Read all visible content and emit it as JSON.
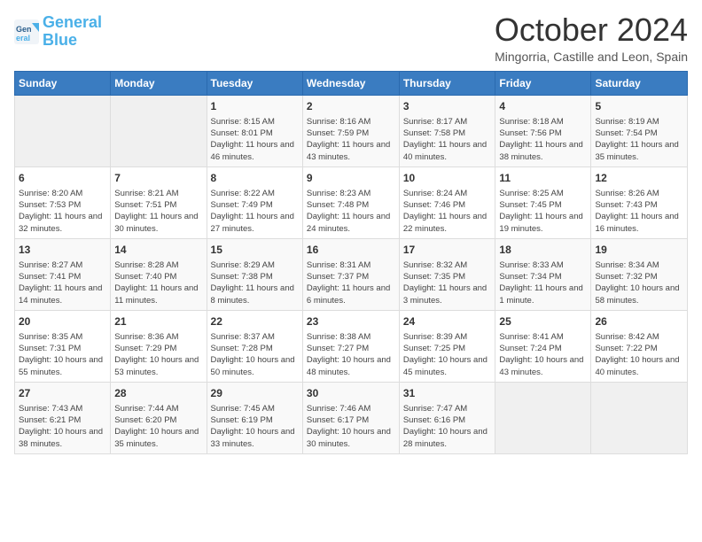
{
  "header": {
    "logo_line1": "General",
    "logo_line2": "Blue",
    "month_title": "October 2024",
    "location": "Mingorria, Castille and Leon, Spain"
  },
  "weekdays": [
    "Sunday",
    "Monday",
    "Tuesday",
    "Wednesday",
    "Thursday",
    "Friday",
    "Saturday"
  ],
  "weeks": [
    [
      {
        "day": "",
        "content": ""
      },
      {
        "day": "",
        "content": ""
      },
      {
        "day": "1",
        "content": "Sunrise: 8:15 AM\nSunset: 8:01 PM\nDaylight: 11 hours and 46 minutes."
      },
      {
        "day": "2",
        "content": "Sunrise: 8:16 AM\nSunset: 7:59 PM\nDaylight: 11 hours and 43 minutes."
      },
      {
        "day": "3",
        "content": "Sunrise: 8:17 AM\nSunset: 7:58 PM\nDaylight: 11 hours and 40 minutes."
      },
      {
        "day": "4",
        "content": "Sunrise: 8:18 AM\nSunset: 7:56 PM\nDaylight: 11 hours and 38 minutes."
      },
      {
        "day": "5",
        "content": "Sunrise: 8:19 AM\nSunset: 7:54 PM\nDaylight: 11 hours and 35 minutes."
      }
    ],
    [
      {
        "day": "6",
        "content": "Sunrise: 8:20 AM\nSunset: 7:53 PM\nDaylight: 11 hours and 32 minutes."
      },
      {
        "day": "7",
        "content": "Sunrise: 8:21 AM\nSunset: 7:51 PM\nDaylight: 11 hours and 30 minutes."
      },
      {
        "day": "8",
        "content": "Sunrise: 8:22 AM\nSunset: 7:49 PM\nDaylight: 11 hours and 27 minutes."
      },
      {
        "day": "9",
        "content": "Sunrise: 8:23 AM\nSunset: 7:48 PM\nDaylight: 11 hours and 24 minutes."
      },
      {
        "day": "10",
        "content": "Sunrise: 8:24 AM\nSunset: 7:46 PM\nDaylight: 11 hours and 22 minutes."
      },
      {
        "day": "11",
        "content": "Sunrise: 8:25 AM\nSunset: 7:45 PM\nDaylight: 11 hours and 19 minutes."
      },
      {
        "day": "12",
        "content": "Sunrise: 8:26 AM\nSunset: 7:43 PM\nDaylight: 11 hours and 16 minutes."
      }
    ],
    [
      {
        "day": "13",
        "content": "Sunrise: 8:27 AM\nSunset: 7:41 PM\nDaylight: 11 hours and 14 minutes."
      },
      {
        "day": "14",
        "content": "Sunrise: 8:28 AM\nSunset: 7:40 PM\nDaylight: 11 hours and 11 minutes."
      },
      {
        "day": "15",
        "content": "Sunrise: 8:29 AM\nSunset: 7:38 PM\nDaylight: 11 hours and 8 minutes."
      },
      {
        "day": "16",
        "content": "Sunrise: 8:31 AM\nSunset: 7:37 PM\nDaylight: 11 hours and 6 minutes."
      },
      {
        "day": "17",
        "content": "Sunrise: 8:32 AM\nSunset: 7:35 PM\nDaylight: 11 hours and 3 minutes."
      },
      {
        "day": "18",
        "content": "Sunrise: 8:33 AM\nSunset: 7:34 PM\nDaylight: 11 hours and 1 minute."
      },
      {
        "day": "19",
        "content": "Sunrise: 8:34 AM\nSunset: 7:32 PM\nDaylight: 10 hours and 58 minutes."
      }
    ],
    [
      {
        "day": "20",
        "content": "Sunrise: 8:35 AM\nSunset: 7:31 PM\nDaylight: 10 hours and 55 minutes."
      },
      {
        "day": "21",
        "content": "Sunrise: 8:36 AM\nSunset: 7:29 PM\nDaylight: 10 hours and 53 minutes."
      },
      {
        "day": "22",
        "content": "Sunrise: 8:37 AM\nSunset: 7:28 PM\nDaylight: 10 hours and 50 minutes."
      },
      {
        "day": "23",
        "content": "Sunrise: 8:38 AM\nSunset: 7:27 PM\nDaylight: 10 hours and 48 minutes."
      },
      {
        "day": "24",
        "content": "Sunrise: 8:39 AM\nSunset: 7:25 PM\nDaylight: 10 hours and 45 minutes."
      },
      {
        "day": "25",
        "content": "Sunrise: 8:41 AM\nSunset: 7:24 PM\nDaylight: 10 hours and 43 minutes."
      },
      {
        "day": "26",
        "content": "Sunrise: 8:42 AM\nSunset: 7:22 PM\nDaylight: 10 hours and 40 minutes."
      }
    ],
    [
      {
        "day": "27",
        "content": "Sunrise: 7:43 AM\nSunset: 6:21 PM\nDaylight: 10 hours and 38 minutes."
      },
      {
        "day": "28",
        "content": "Sunrise: 7:44 AM\nSunset: 6:20 PM\nDaylight: 10 hours and 35 minutes."
      },
      {
        "day": "29",
        "content": "Sunrise: 7:45 AM\nSunset: 6:19 PM\nDaylight: 10 hours and 33 minutes."
      },
      {
        "day": "30",
        "content": "Sunrise: 7:46 AM\nSunset: 6:17 PM\nDaylight: 10 hours and 30 minutes."
      },
      {
        "day": "31",
        "content": "Sunrise: 7:47 AM\nSunset: 6:16 PM\nDaylight: 10 hours and 28 minutes."
      },
      {
        "day": "",
        "content": ""
      },
      {
        "day": "",
        "content": ""
      }
    ]
  ]
}
